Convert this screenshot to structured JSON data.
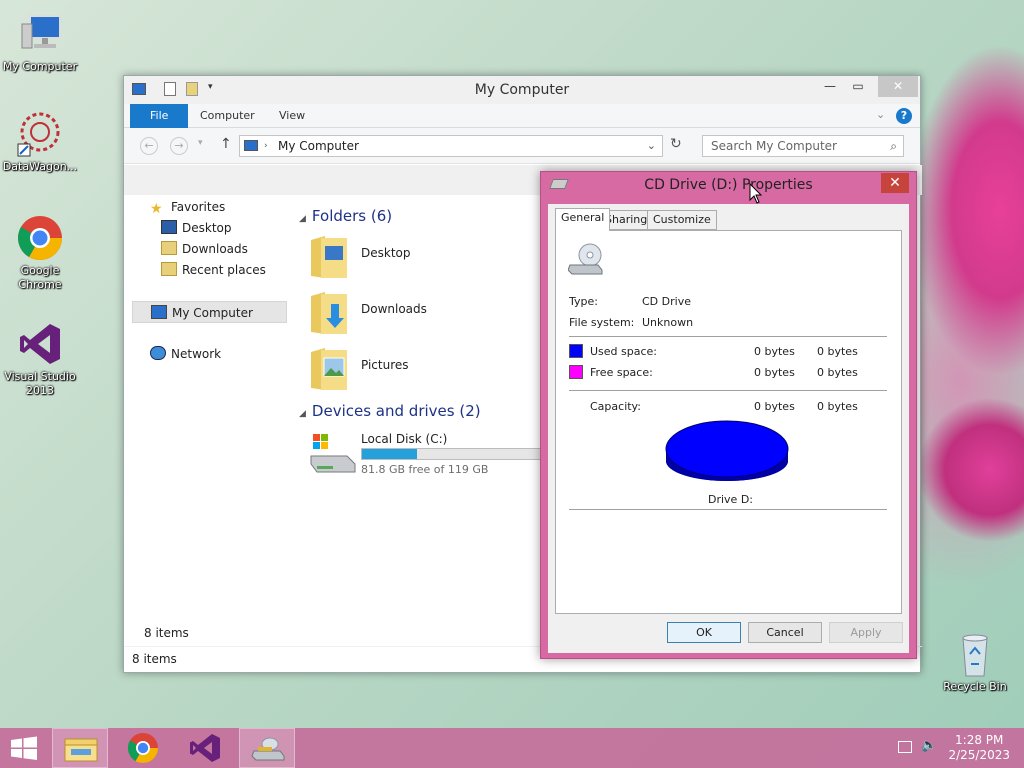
{
  "desktop": {
    "icons": [
      {
        "label": "My Computer"
      },
      {
        "label": "DataWagon..."
      },
      {
        "label": "Google Chrome"
      },
      {
        "label": "Visual Studio 2013"
      },
      {
        "label": "Recycle Bin"
      }
    ]
  },
  "explorer": {
    "title": "My Computer",
    "ribbon_tabs": [
      "File",
      "Computer",
      "View"
    ],
    "address": "My Computer",
    "search_placeholder": "Search My Computer",
    "nav": {
      "favorites": "Favorites",
      "desktop": "Desktop",
      "downloads": "Downloads",
      "recent": "Recent places",
      "my_computer": "My Computer",
      "network": "Network"
    },
    "folders_header": "Folders (6)",
    "folders": [
      "Desktop",
      "Downloads",
      "Pictures"
    ],
    "devices_header": "Devices and drives (2)",
    "drive": {
      "name": "Local Disk (C:)",
      "free_text": "81.8 GB free of 119 GB",
      "used_fraction": 0.31
    },
    "items_count_nav": "8 items",
    "items_count_status": "8 items"
  },
  "dialog": {
    "title": "CD Drive (D:) Properties",
    "close": "✕",
    "tabs": [
      "General",
      "Sharing",
      "Customize"
    ],
    "type_label": "Type:",
    "type_value": "CD Drive",
    "fs_label": "File system:",
    "fs_value": "Unknown",
    "used_label": "Used space:",
    "used_bytes": "0 bytes",
    "used_bytes2": "0 bytes",
    "free_label": "Free space:",
    "free_bytes": "0 bytes",
    "free_bytes2": "0 bytes",
    "capacity_label": "Capacity:",
    "capacity_bytes": "0 bytes",
    "capacity_bytes2": "0 bytes",
    "drive_label": "Drive D:",
    "ok": "OK",
    "cancel": "Cancel",
    "apply": "Apply",
    "colors": {
      "used": "#0000ff",
      "free": "#ff00ff"
    }
  },
  "taskbar": {
    "time": "1:28 PM",
    "date": "2/25/2023"
  }
}
